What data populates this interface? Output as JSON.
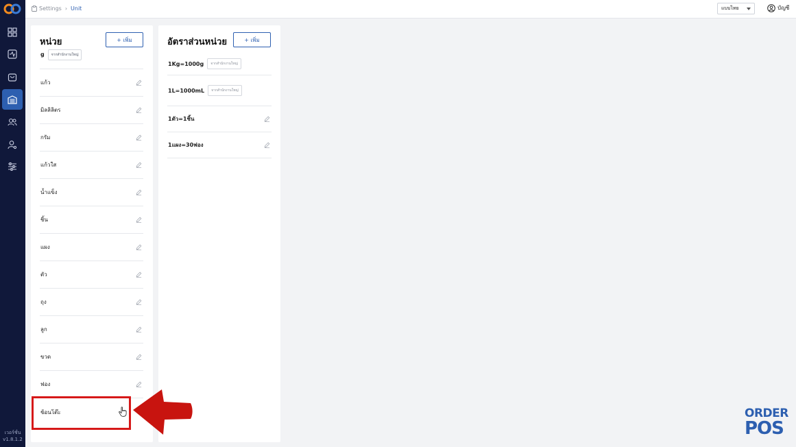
{
  "sidebar": {
    "version_label": "เวอร์ชั่น",
    "version_number": "v1.8.1.2"
  },
  "topbar": {
    "breadcrumb": [
      "Settings",
      "Unit"
    ],
    "language": "แบบไทย",
    "account": "บัญชี"
  },
  "units_panel": {
    "title": "หน่วย",
    "add_label": "+ เพิ่ม",
    "partial_item": {
      "label": "g",
      "tag": "จากสำนักงานใหญ่"
    },
    "items": [
      "แก้ว",
      "มิลลิลิตร",
      "กรัม",
      "แก้วใส",
      "น้ำแข็ง",
      "ชิ้น",
      "แผง",
      "ตัว",
      "ถุง",
      "ลูก",
      "ขวด",
      "ฟอง",
      "ช้อนโต๊ะ"
    ]
  },
  "ratio_panel": {
    "title": "อัตราส่วนหน่วย",
    "add_label": "+ เพิ่ม",
    "items": [
      {
        "label": "1Kg=1000g",
        "tag": "จากสำนักงานใหญ่"
      },
      {
        "label": "1L=1000mL",
        "tag": "จากสำนักงานใหญ่"
      },
      {
        "label": "1ตัว=1ชิ้น",
        "tag": ""
      },
      {
        "label": "1แผง=30ฟอง",
        "tag": ""
      }
    ]
  },
  "brand": {
    "line1": "ORDER",
    "line2": "POS"
  },
  "colors": {
    "accent": "#2d5fb0",
    "sidebar": "#10183a",
    "highlight": "#d61919"
  }
}
